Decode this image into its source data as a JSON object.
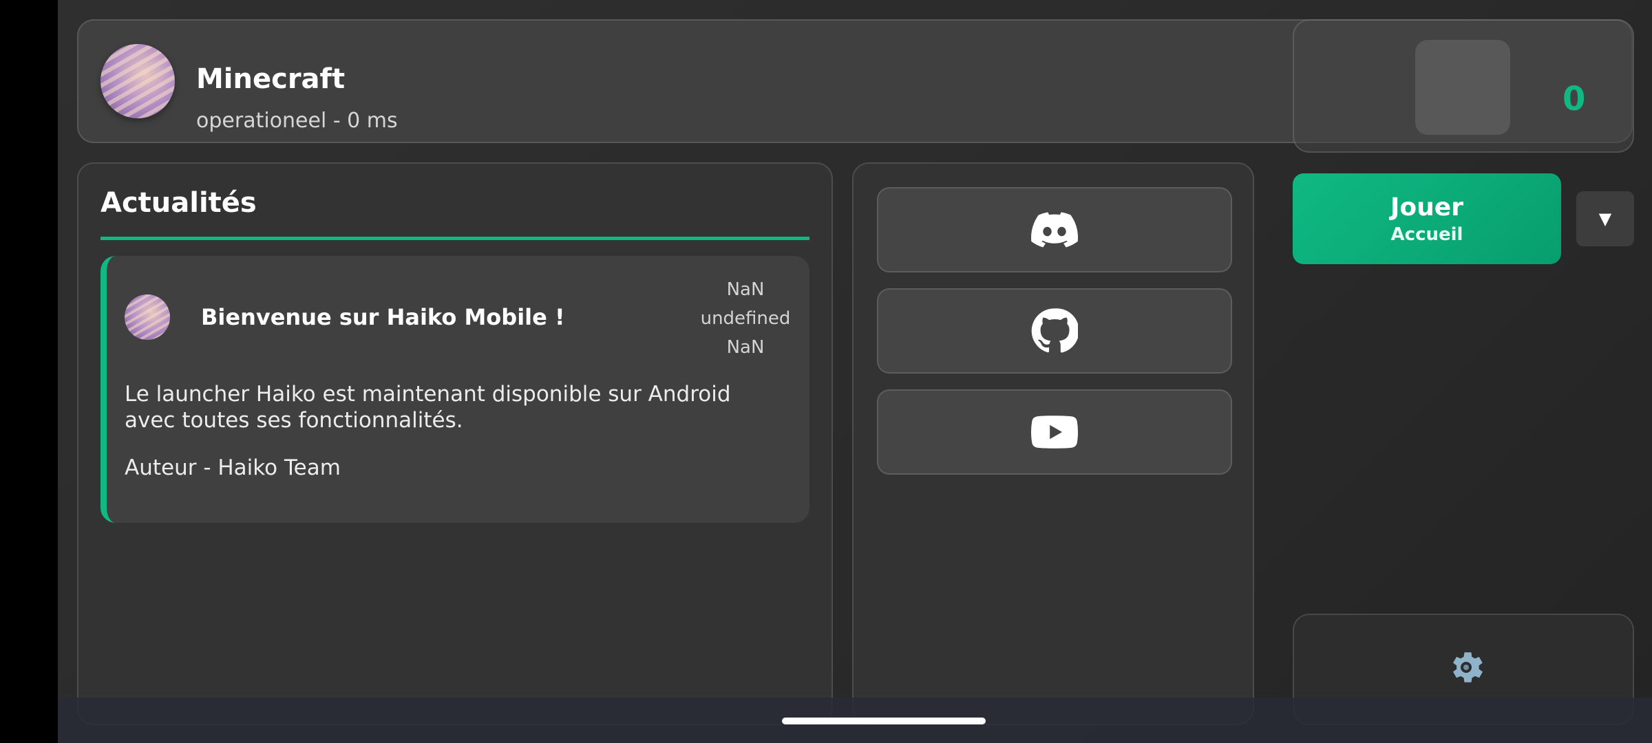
{
  "server": {
    "name": "Minecraft",
    "status": "operationeel - 0 ms"
  },
  "account": {
    "count": "0"
  },
  "news": {
    "title": "Actualités",
    "items": [
      {
        "title": "Bienvenue sur Haiko Mobile !",
        "date_day": "NaN",
        "date_month": "undefined",
        "date_year": "NaN",
        "body": "Le launcher Haiko est maintenant disponible sur Android avec toutes ses fonctionnalités.",
        "author": "Auteur - Haiko Team"
      }
    ]
  },
  "social": {
    "buttons": [
      "discord-icon",
      "github-icon",
      "youtube-icon"
    ]
  },
  "play": {
    "label": "Jouer",
    "sublabel": "Accueil",
    "dropdown_glyph": "▼"
  },
  "settings": {
    "icon": "gear-icon"
  },
  "colors": {
    "accent": "#10b981",
    "panel": "#404040",
    "background": "#2b2b2b"
  }
}
